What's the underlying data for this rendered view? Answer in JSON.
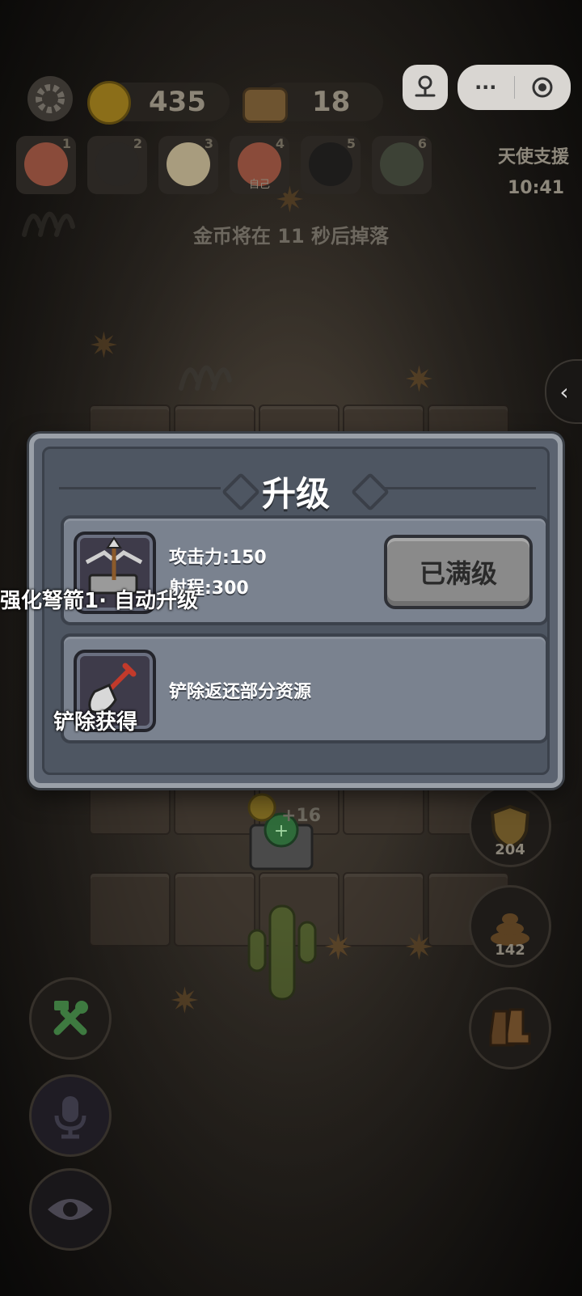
{
  "hud": {
    "coins": "435",
    "wood": "18",
    "capsule_more": "···",
    "avatars": [
      {
        "num": "1",
        "self": "",
        "color": "#8a4b3a"
      },
      {
        "num": "2",
        "self": "",
        "color": "#2a2724"
      },
      {
        "num": "3",
        "self": "",
        "color": "#a89c7e"
      },
      {
        "num": "4",
        "self": "自己",
        "color": "#8a4b3a"
      },
      {
        "num": "5",
        "self": "",
        "color": "#1d1c1b"
      },
      {
        "num": "6",
        "self": "",
        "color": "#3d4236"
      }
    ],
    "angel_support": "天使支援",
    "angel_timer": "10:41",
    "drop_message": "金币将在 11 秒后掉落"
  },
  "modal": {
    "title": "升级",
    "upgrade": {
      "attack": "攻击力:150",
      "range": "射程:300",
      "button": "已满级",
      "overlay_label": "强化弩箭1· 自动升级"
    },
    "shovel": {
      "description": "铲除返还部分资源",
      "overlay_label": "铲除获得"
    }
  },
  "field": {
    "tower_plus": "+16"
  },
  "right_buttons": {
    "shield_count": "204",
    "poop_count": "142"
  },
  "colors": {
    "modal_bg": "#5b6370",
    "card_bg": "#7a828f",
    "button_gray": "#8a8a8a"
  }
}
